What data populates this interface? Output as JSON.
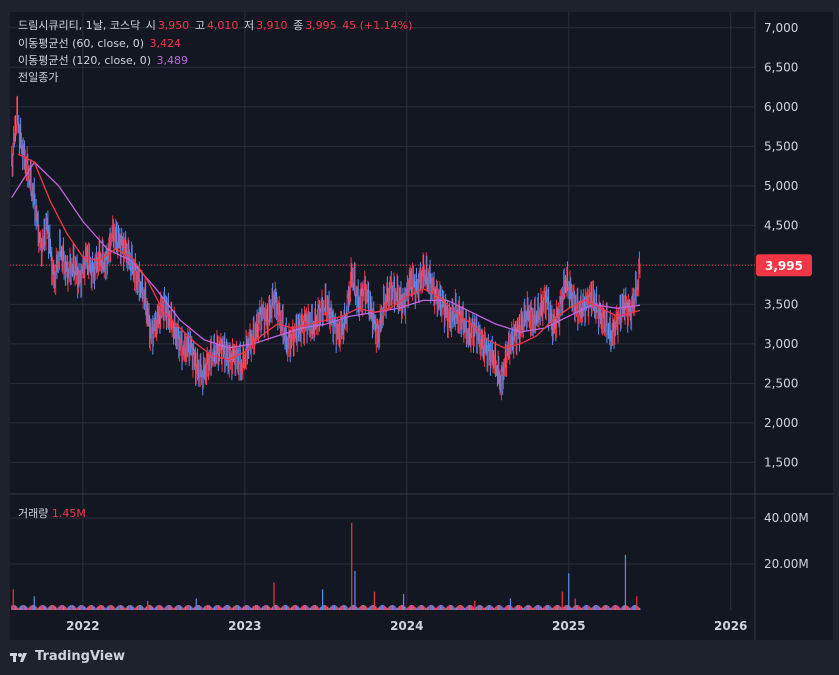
{
  "legend": {
    "name": "드림시큐리티, 1날, 코스닥",
    "open_label": "시",
    "open": "3,950",
    "high_label": "고",
    "high": "4,010",
    "low_label": "저",
    "low": "3,910",
    "close_label": "종",
    "close": "3,995",
    "change": "45 (+1.14%)",
    "ma60_label": "이동평균선 (60, close, 0)",
    "ma60_value": "3,424",
    "ma120_label": "이동평균선 (120, close, 0)",
    "ma120_value": "3,489",
    "prev_close_label": "전일종가"
  },
  "volume_legend": {
    "label": "거래량",
    "value": "1.45M"
  },
  "price_tag": "3,995",
  "brand": "TradingView",
  "colors": {
    "background": "#1e222d",
    "up": "#f23645",
    "down": "#5b8def",
    "ma60": "#f23645",
    "ma120": "#c065e0",
    "grid": "#2a2e39",
    "text": "#d1d4dc"
  },
  "chart_data": {
    "type": "line",
    "price_axis": {
      "ticks": [
        "7,000",
        "6,500",
        "6,000",
        "5,500",
        "5,000",
        "4,500",
        "4,000",
        "3,500",
        "3,000",
        "2,500",
        "2,000",
        "1,500"
      ],
      "values": [
        7000,
        6500,
        6000,
        5500,
        5000,
        4500,
        4000,
        3500,
        3000,
        2500,
        2000,
        1500
      ],
      "range": [
        1100,
        7200
      ]
    },
    "volume_axis": {
      "ticks": [
        "40.00M",
        "20.00M"
      ],
      "values": [
        40,
        20
      ],
      "range": [
        0,
        47
      ]
    },
    "x_axis": {
      "ticks": [
        "2022",
        "2023",
        "2024",
        "2025",
        "2026"
      ],
      "tick_times": [
        2022.0,
        2023.0,
        2024.0,
        2025.0,
        2026.0
      ],
      "range": [
        2021.55,
        2026.15
      ]
    },
    "last_price": 3995,
    "price_series": [
      {
        "t": 2021.56,
        "v": 5300
      },
      {
        "t": 2021.59,
        "v": 5900
      },
      {
        "t": 2021.62,
        "v": 5500
      },
      {
        "t": 2021.66,
        "v": 5200
      },
      {
        "t": 2021.7,
        "v": 4800
      },
      {
        "t": 2021.74,
        "v": 4200
      },
      {
        "t": 2021.78,
        "v": 4500
      },
      {
        "t": 2021.82,
        "v": 3800
      },
      {
        "t": 2021.86,
        "v": 4200
      },
      {
        "t": 2021.9,
        "v": 3900
      },
      {
        "t": 2021.94,
        "v": 4000
      },
      {
        "t": 2021.98,
        "v": 3800
      },
      {
        "t": 2022.02,
        "v": 4100
      },
      {
        "t": 2022.06,
        "v": 3900
      },
      {
        "t": 2022.1,
        "v": 4100
      },
      {
        "t": 2022.14,
        "v": 4000
      },
      {
        "t": 2022.18,
        "v": 4400
      },
      {
        "t": 2022.22,
        "v": 4300
      },
      {
        "t": 2022.26,
        "v": 4200
      },
      {
        "t": 2022.3,
        "v": 4000
      },
      {
        "t": 2022.34,
        "v": 3800
      },
      {
        "t": 2022.38,
        "v": 3600
      },
      {
        "t": 2022.42,
        "v": 3100
      },
      {
        "t": 2022.46,
        "v": 3300
      },
      {
        "t": 2022.5,
        "v": 3500
      },
      {
        "t": 2022.54,
        "v": 3300
      },
      {
        "t": 2022.58,
        "v": 3100
      },
      {
        "t": 2022.62,
        "v": 2900
      },
      {
        "t": 2022.66,
        "v": 3000
      },
      {
        "t": 2022.7,
        "v": 2700
      },
      {
        "t": 2022.74,
        "v": 2600
      },
      {
        "t": 2022.78,
        "v": 2800
      },
      {
        "t": 2022.82,
        "v": 2900
      },
      {
        "t": 2022.86,
        "v": 2950
      },
      {
        "t": 2022.9,
        "v": 2800
      },
      {
        "t": 2022.94,
        "v": 2850
      },
      {
        "t": 2022.98,
        "v": 2700
      },
      {
        "t": 2023.02,
        "v": 3000
      },
      {
        "t": 2023.06,
        "v": 3100
      },
      {
        "t": 2023.1,
        "v": 3400
      },
      {
        "t": 2023.14,
        "v": 3300
      },
      {
        "t": 2023.18,
        "v": 3600
      },
      {
        "t": 2023.22,
        "v": 3300
      },
      {
        "t": 2023.26,
        "v": 3000
      },
      {
        "t": 2023.3,
        "v": 3100
      },
      {
        "t": 2023.34,
        "v": 3200
      },
      {
        "t": 2023.38,
        "v": 3300
      },
      {
        "t": 2023.42,
        "v": 3200
      },
      {
        "t": 2023.46,
        "v": 3400
      },
      {
        "t": 2023.5,
        "v": 3500
      },
      {
        "t": 2023.54,
        "v": 3300
      },
      {
        "t": 2023.58,
        "v": 3100
      },
      {
        "t": 2023.62,
        "v": 3300
      },
      {
        "t": 2023.66,
        "v": 3900
      },
      {
        "t": 2023.7,
        "v": 3500
      },
      {
        "t": 2023.74,
        "v": 3700
      },
      {
        "t": 2023.78,
        "v": 3400
      },
      {
        "t": 2023.82,
        "v": 3100
      },
      {
        "t": 2023.86,
        "v": 3500
      },
      {
        "t": 2023.9,
        "v": 3700
      },
      {
        "t": 2023.94,
        "v": 3600
      },
      {
        "t": 2023.98,
        "v": 3500
      },
      {
        "t": 2024.02,
        "v": 3800
      },
      {
        "t": 2024.06,
        "v": 3700
      },
      {
        "t": 2024.1,
        "v": 3900
      },
      {
        "t": 2024.14,
        "v": 3800
      },
      {
        "t": 2024.18,
        "v": 3600
      },
      {
        "t": 2024.22,
        "v": 3500
      },
      {
        "t": 2024.26,
        "v": 3300
      },
      {
        "t": 2024.3,
        "v": 3400
      },
      {
        "t": 2024.34,
        "v": 3300
      },
      {
        "t": 2024.38,
        "v": 3100
      },
      {
        "t": 2024.42,
        "v": 3200
      },
      {
        "t": 2024.46,
        "v": 3000
      },
      {
        "t": 2024.5,
        "v": 2900
      },
      {
        "t": 2024.54,
        "v": 2800
      },
      {
        "t": 2024.58,
        "v": 2500
      },
      {
        "t": 2024.62,
        "v": 2900
      },
      {
        "t": 2024.66,
        "v": 3100
      },
      {
        "t": 2024.7,
        "v": 3200
      },
      {
        "t": 2024.74,
        "v": 3400
      },
      {
        "t": 2024.78,
        "v": 3300
      },
      {
        "t": 2024.82,
        "v": 3400
      },
      {
        "t": 2024.86,
        "v": 3600
      },
      {
        "t": 2024.9,
        "v": 3200
      },
      {
        "t": 2024.94,
        "v": 3400
      },
      {
        "t": 2024.98,
        "v": 3800
      },
      {
        "t": 2025.02,
        "v": 3600
      },
      {
        "t": 2025.06,
        "v": 3400
      },
      {
        "t": 2025.1,
        "v": 3500
      },
      {
        "t": 2025.14,
        "v": 3600
      },
      {
        "t": 2025.18,
        "v": 3400
      },
      {
        "t": 2025.22,
        "v": 3300
      },
      {
        "t": 2025.26,
        "v": 3100
      },
      {
        "t": 2025.3,
        "v": 3300
      },
      {
        "t": 2025.34,
        "v": 3500
      },
      {
        "t": 2025.38,
        "v": 3400
      },
      {
        "t": 2025.42,
        "v": 3700
      },
      {
        "t": 2025.44,
        "v": 3995
      }
    ],
    "ma60_series": [
      {
        "t": 2021.6,
        "v": 5400
      },
      {
        "t": 2021.7,
        "v": 5300
      },
      {
        "t": 2021.8,
        "v": 4800
      },
      {
        "t": 2021.9,
        "v": 4400
      },
      {
        "t": 2022.0,
        "v": 4100
      },
      {
        "t": 2022.1,
        "v": 4050
      },
      {
        "t": 2022.2,
        "v": 4200
      },
      {
        "t": 2022.3,
        "v": 4100
      },
      {
        "t": 2022.4,
        "v": 3800
      },
      {
        "t": 2022.5,
        "v": 3400
      },
      {
        "t": 2022.6,
        "v": 3200
      },
      {
        "t": 2022.7,
        "v": 3000
      },
      {
        "t": 2022.8,
        "v": 2850
      },
      {
        "t": 2022.9,
        "v": 2800
      },
      {
        "t": 2023.0,
        "v": 2900
      },
      {
        "t": 2023.1,
        "v": 3100
      },
      {
        "t": 2023.2,
        "v": 3250
      },
      {
        "t": 2023.3,
        "v": 3200
      },
      {
        "t": 2023.4,
        "v": 3250
      },
      {
        "t": 2023.5,
        "v": 3300
      },
      {
        "t": 2023.6,
        "v": 3350
      },
      {
        "t": 2023.7,
        "v": 3450
      },
      {
        "t": 2023.8,
        "v": 3400
      },
      {
        "t": 2023.9,
        "v": 3450
      },
      {
        "t": 2024.0,
        "v": 3600
      },
      {
        "t": 2024.1,
        "v": 3700
      },
      {
        "t": 2024.2,
        "v": 3600
      },
      {
        "t": 2024.3,
        "v": 3400
      },
      {
        "t": 2024.4,
        "v": 3250
      },
      {
        "t": 2024.5,
        "v": 3050
      },
      {
        "t": 2024.6,
        "v": 2950
      },
      {
        "t": 2024.7,
        "v": 3000
      },
      {
        "t": 2024.8,
        "v": 3100
      },
      {
        "t": 2024.9,
        "v": 3300
      },
      {
        "t": 2025.0,
        "v": 3450
      },
      {
        "t": 2025.1,
        "v": 3550
      },
      {
        "t": 2025.2,
        "v": 3450
      },
      {
        "t": 2025.3,
        "v": 3350
      },
      {
        "t": 2025.44,
        "v": 3424
      }
    ],
    "ma120_series": [
      {
        "t": 2021.56,
        "v": 4850
      },
      {
        "t": 2021.7,
        "v": 5300
      },
      {
        "t": 2021.85,
        "v": 5000
      },
      {
        "t": 2022.0,
        "v": 4550
      },
      {
        "t": 2022.15,
        "v": 4200
      },
      {
        "t": 2022.3,
        "v": 4050
      },
      {
        "t": 2022.45,
        "v": 3700
      },
      {
        "t": 2022.6,
        "v": 3300
      },
      {
        "t": 2022.75,
        "v": 3050
      },
      {
        "t": 2022.9,
        "v": 2950
      },
      {
        "t": 2023.05,
        "v": 3000
      },
      {
        "t": 2023.2,
        "v": 3100
      },
      {
        "t": 2023.35,
        "v": 3200
      },
      {
        "t": 2023.5,
        "v": 3250
      },
      {
        "t": 2023.65,
        "v": 3350
      },
      {
        "t": 2023.8,
        "v": 3400
      },
      {
        "t": 2023.95,
        "v": 3450
      },
      {
        "t": 2024.1,
        "v": 3550
      },
      {
        "t": 2024.25,
        "v": 3550
      },
      {
        "t": 2024.4,
        "v": 3400
      },
      {
        "t": 2024.55,
        "v": 3250
      },
      {
        "t": 2024.7,
        "v": 3150
      },
      {
        "t": 2024.85,
        "v": 3200
      },
      {
        "t": 2025.0,
        "v": 3350
      },
      {
        "t": 2025.15,
        "v": 3500
      },
      {
        "t": 2025.3,
        "v": 3450
      },
      {
        "t": 2025.44,
        "v": 3489
      }
    ],
    "volume_series": [
      {
        "t": 2021.57,
        "v": 9
      },
      {
        "t": 2021.7,
        "v": 6
      },
      {
        "t": 2022.4,
        "v": 4
      },
      {
        "t": 2022.7,
        "v": 5
      },
      {
        "t": 2023.18,
        "v": 12
      },
      {
        "t": 2023.48,
        "v": 9
      },
      {
        "t": 2023.66,
        "v": 38
      },
      {
        "t": 2023.68,
        "v": 17
      },
      {
        "t": 2023.8,
        "v": 8
      },
      {
        "t": 2023.98,
        "v": 7
      },
      {
        "t": 2024.42,
        "v": 4
      },
      {
        "t": 2024.64,
        "v": 5
      },
      {
        "t": 2024.96,
        "v": 8
      },
      {
        "t": 2025.0,
        "v": 16
      },
      {
        "t": 2025.04,
        "v": 5
      },
      {
        "t": 2025.35,
        "v": 24
      },
      {
        "t": 2025.42,
        "v": 6
      }
    ]
  }
}
